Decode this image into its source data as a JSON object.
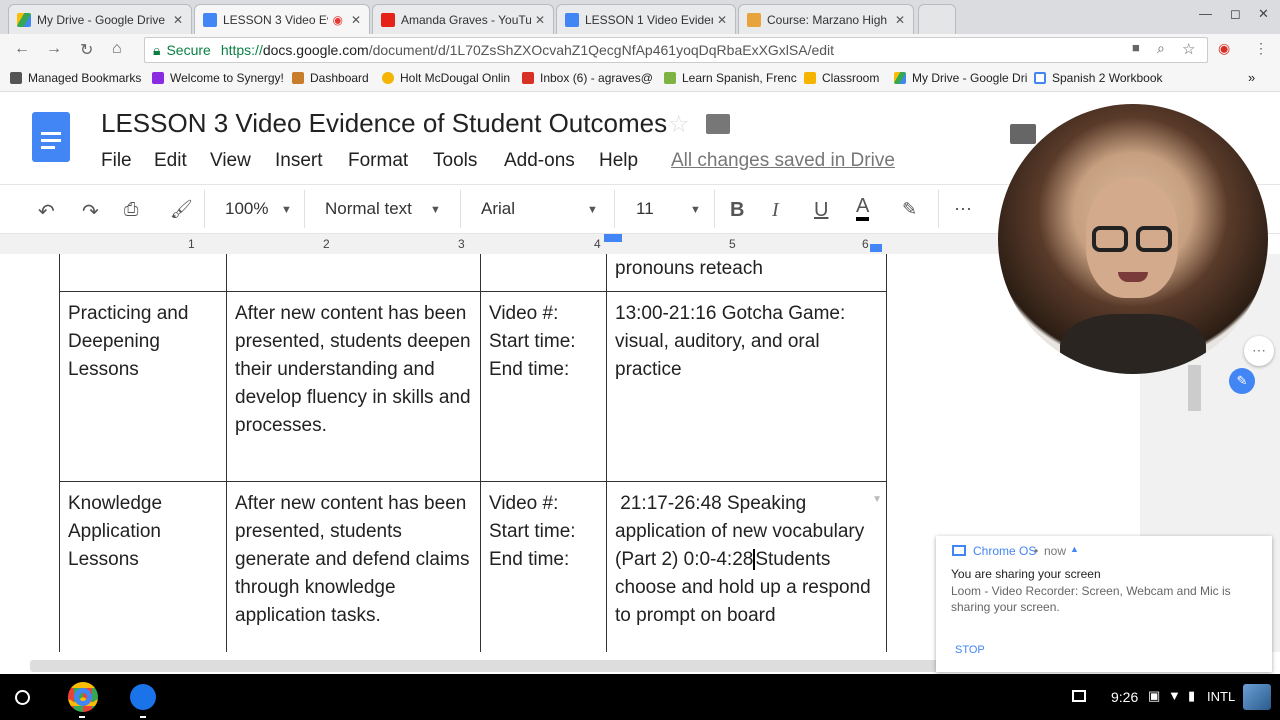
{
  "tabs": [
    {
      "title": "My Drive - Google Drive",
      "icon": "google-drive-icon"
    },
    {
      "title": "LESSON 3 Video Evid",
      "icon": "google-docs-icon",
      "active": true
    },
    {
      "title": "Amanda Graves - YouTu",
      "icon": "youtube-icon"
    },
    {
      "title": "LESSON 1 Video Evidenc",
      "icon": "google-docs-icon"
    },
    {
      "title": "Course: Marzano High R",
      "icon": "course-icon"
    }
  ],
  "address": {
    "secure_label": "Secure",
    "url_scheme": "https://",
    "url_domain": "docs.google.com",
    "url_path": "/document/d/1L70ZsShZXOcvahZ1QecgNfAp461yoqDqRbaExXGxlSA/edit"
  },
  "bookmarks": [
    {
      "label": "Managed Bookmarks",
      "icon": "folder-icon"
    },
    {
      "label": "Welcome to Synergy!",
      "icon": "synergy-icon"
    },
    {
      "label": "Dashboard",
      "icon": "dashboard-icon"
    },
    {
      "label": "Holt McDougal Onlin",
      "icon": "holt-icon"
    },
    {
      "label": "Inbox (6) - agraves@",
      "icon": "gmail-icon"
    },
    {
      "label": "Learn Spanish, Frenc",
      "icon": "learn-icon"
    },
    {
      "label": "Classroom",
      "icon": "classroom-icon"
    },
    {
      "label": "My Drive - Google Dri",
      "icon": "google-drive-icon"
    },
    {
      "label": "Spanish 2 Workbook",
      "icon": "workbook-icon"
    }
  ],
  "document": {
    "title": "LESSON 3 Video Evidence of Student Outcomes",
    "menu": [
      "File",
      "Edit",
      "View",
      "Insert",
      "Format",
      "Tools",
      "Add-ons",
      "Help"
    ],
    "saved_status": "All changes saved in Drive"
  },
  "toolbar": {
    "zoom": "100%",
    "style": "Normal text",
    "font": "Arial",
    "size": "11",
    "bold": "B",
    "italic": "I",
    "underline": "U",
    "textcolor": "A"
  },
  "ruler": [
    "1",
    "2",
    "3",
    "4",
    "5",
    "6"
  ],
  "table": {
    "top_partial": "pronouns reteach",
    "rows": [
      {
        "type": "Practicing and Deepening Lessons",
        "description": "After new content has been presented, students deepen their understanding and develop fluency in skills and processes.",
        "video_lines": [
          "Video #:",
          "Start time:",
          "End time:"
        ],
        "evidence": "13:00-21:16 Gotcha Game: visual, auditory, and oral practice"
      },
      {
        "type": "Knowledge Application Lessons",
        "description": "After new content has been presented, students generate and defend claims through knowledge application tasks.",
        "video_lines": [
          "Video #:",
          "Start time:",
          "End time:"
        ],
        "evidence_a": " 21:17-26:48 Speaking application of new vocabulary",
        "evidence_b": "(Part 2) 0:0-4:28",
        "evidence_c": "Students choose and hold up a respond to prompt on board"
      }
    ]
  },
  "notification": {
    "app": "Chrome OS",
    "time": "now",
    "title": "You are sharing your screen",
    "body": "Loom - Video Recorder: Screen, Webcam and Mic is sharing your screen.",
    "action": "STOP"
  },
  "shelf": {
    "time": "9:26",
    "ime": "INTL"
  }
}
